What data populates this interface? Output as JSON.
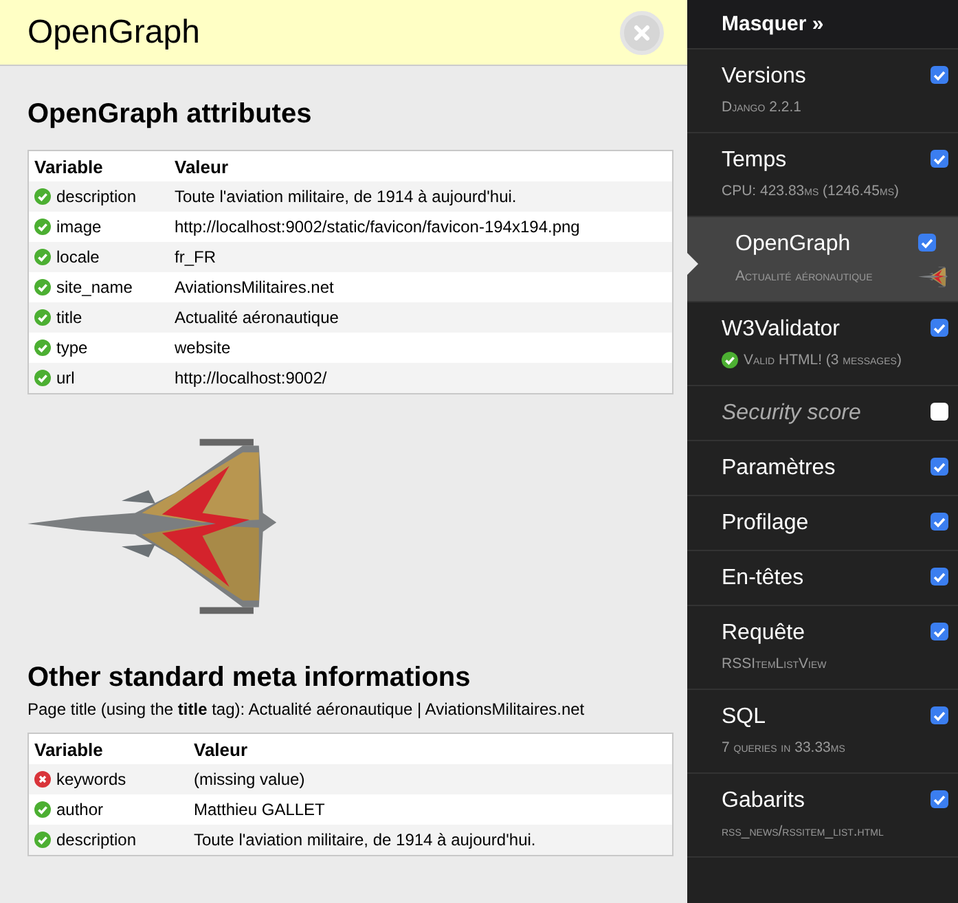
{
  "panel": {
    "title": "OpenGraph"
  },
  "og_section": {
    "heading": "OpenGraph attributes",
    "columns": [
      "Variable",
      "Valeur"
    ],
    "rows": [
      {
        "valid": true,
        "variable": "description",
        "value": "Toute l'aviation militaire, de 1914 à aujourd'hui."
      },
      {
        "valid": true,
        "variable": "image",
        "value": "http://localhost:9002/static/favicon/favicon-194x194.png"
      },
      {
        "valid": true,
        "variable": "locale",
        "value": "fr_FR"
      },
      {
        "valid": true,
        "variable": "site_name",
        "value": "AviationsMilitaires.net"
      },
      {
        "valid": true,
        "variable": "title",
        "value": "Actualité aéronautique"
      },
      {
        "valid": true,
        "variable": "type",
        "value": "website"
      },
      {
        "valid": true,
        "variable": "url",
        "value": "http://localhost:9002/"
      }
    ]
  },
  "meta_section": {
    "heading": "Other standard meta informations",
    "page_title": "Page title (using the **title** tag): Actualité aéronautique | AviationsMilitaires.net",
    "columns": [
      "Variable",
      "Valeur"
    ],
    "rows": [
      {
        "valid": false,
        "variable": "keywords",
        "value": "(missing value)"
      },
      {
        "valid": true,
        "variable": "author",
        "value": "Matthieu GALLET"
      },
      {
        "valid": true,
        "variable": "description",
        "value": "Toute l'aviation militaire, de 1914 à aujourd'hui."
      }
    ]
  },
  "toolbar": {
    "hide_label": "Masquer »",
    "items": [
      {
        "kind": "text",
        "title": "Versions",
        "subtitle": "Django 2.2.1",
        "checked": true,
        "selected": false,
        "disabled": false
      },
      {
        "kind": "text",
        "title": "Temps",
        "subtitle": "CPU: 423.83ms (1246.45ms)",
        "checked": true,
        "selected": false,
        "disabled": false
      },
      {
        "kind": "image",
        "title": "OpenGraph",
        "subtitle": "Actualité aéronautique",
        "checked": true,
        "selected": true,
        "disabled": false
      },
      {
        "kind": "status",
        "title": "W3Validator",
        "subtitle": "Valid HTML! (3 messages)",
        "checked": true,
        "selected": false,
        "disabled": false
      },
      {
        "kind": "text",
        "title": "Security score",
        "checked": false,
        "selected": false,
        "disabled": true
      },
      {
        "kind": "text",
        "title": "Paramètres",
        "checked": true,
        "selected": false,
        "disabled": false
      },
      {
        "kind": "text",
        "title": "Profilage",
        "checked": true,
        "selected": false,
        "disabled": false
      },
      {
        "kind": "text",
        "title": "En-têtes",
        "checked": true,
        "selected": false,
        "disabled": false
      },
      {
        "kind": "text",
        "title": "Requête",
        "subtitle": "RSSItemListView",
        "checked": true,
        "selected": false,
        "disabled": false
      },
      {
        "kind": "text",
        "title": "SQL",
        "subtitle": "7 queries in 33.33ms",
        "checked": true,
        "selected": false,
        "disabled": false
      },
      {
        "kind": "text",
        "title": "Gabarits",
        "subtitle": "rss_news/rssitem_list.html",
        "checked": true,
        "selected": false,
        "disabled": false
      }
    ]
  }
}
